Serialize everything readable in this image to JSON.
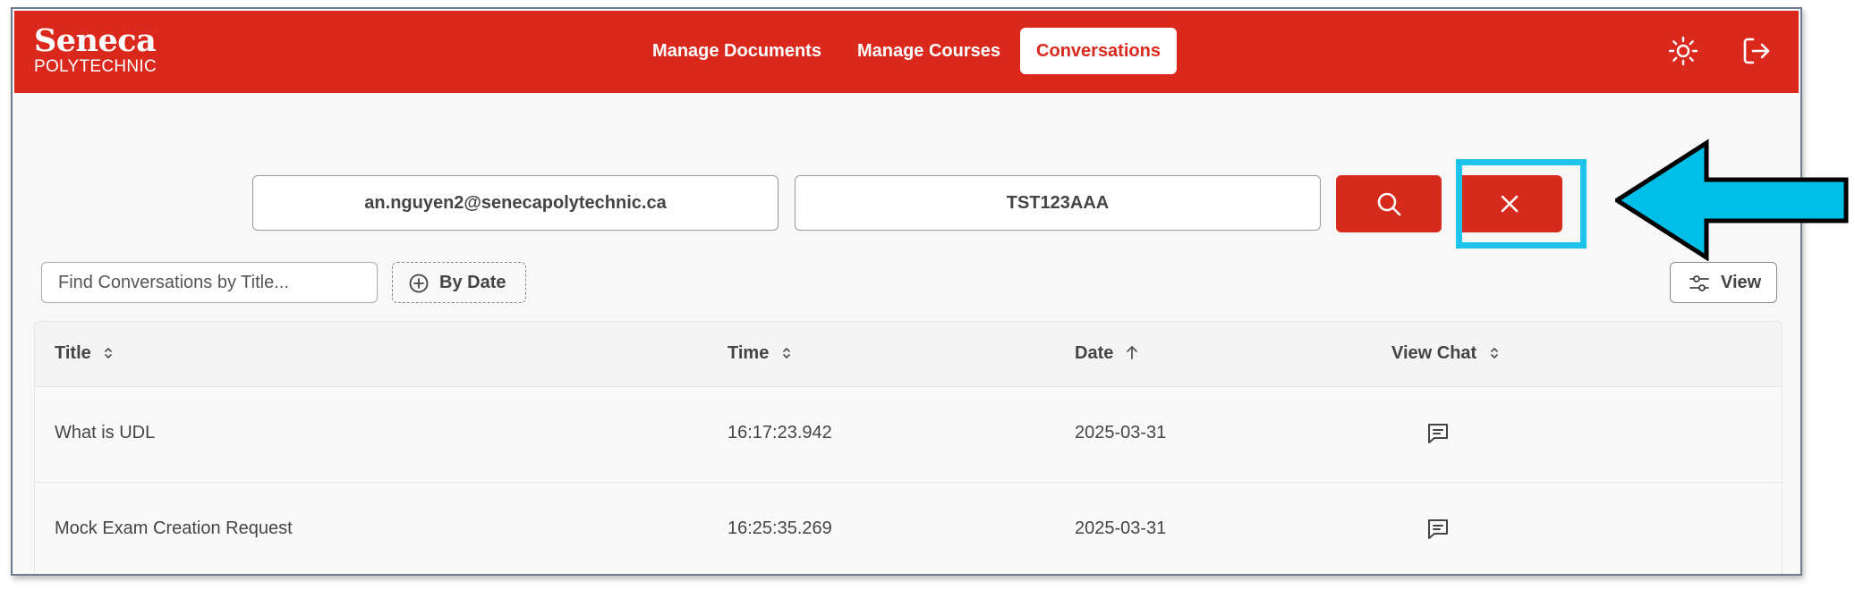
{
  "brand": {
    "line1": "Seneca",
    "line2": "POLYTECHNIC"
  },
  "nav": {
    "items": [
      {
        "label": "Manage Documents"
      },
      {
        "label": "Manage Courses"
      },
      {
        "label": "Conversations"
      }
    ]
  },
  "header_icons": [
    "sun-icon",
    "logout-icon"
  ],
  "search": {
    "email_value": "an.nguyen2@senecapolytechnic.ca",
    "course_value": "TST123AAA"
  },
  "filters": {
    "title_placeholder": "Find Conversations by Title...",
    "by_date_label": "By Date",
    "view_label": "View"
  },
  "table": {
    "headers": {
      "title": "Title",
      "time": "Time",
      "date": "Date",
      "view_chat": "View Chat"
    },
    "rows": [
      {
        "title": "What is UDL",
        "time": "16:17:23.942",
        "date": "2025-03-31"
      },
      {
        "title": "Mock Exam Creation Request",
        "time": "16:25:35.269",
        "date": "2025-03-31"
      }
    ]
  },
  "colors": {
    "brand_red": "#da291c",
    "highlight": "#1ec3ea",
    "arrow": "#00bfe6"
  }
}
